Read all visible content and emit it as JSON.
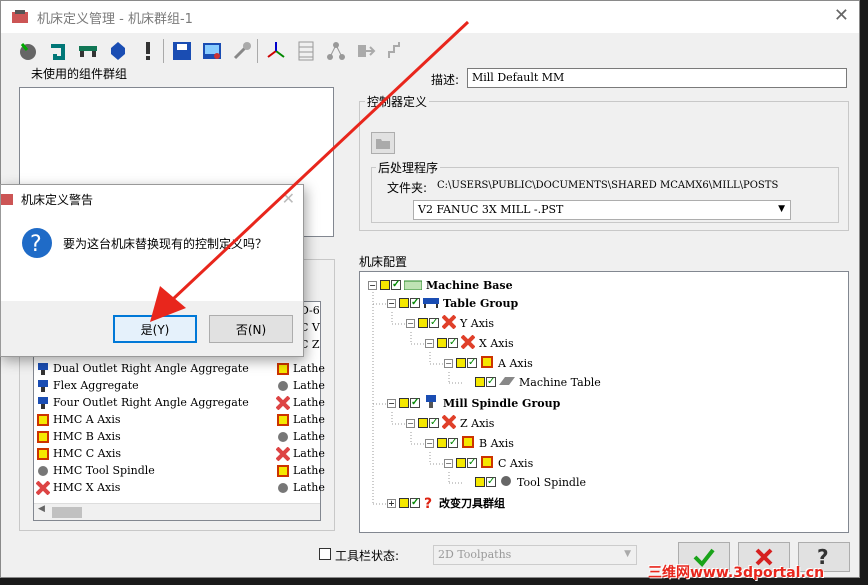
{
  "window": {
    "title": "机床定义管理 - 机床群组-1"
  },
  "toolbar": {
    "icons": [
      "machine-icon",
      "rotate-icon",
      "axis-icon",
      "spindle-icon",
      "warning-icon",
      "save-icon",
      "display-icon",
      "tool-icon",
      "axes-icon",
      "table-icon",
      "tree-icon",
      "export-icon",
      "chart-icon"
    ]
  },
  "left": {
    "unused_label": "未使用的组件群组",
    "list_right_partial": [
      "D-6",
      "C V",
      "C Z"
    ],
    "list_left": [
      {
        "icon": "aggregate",
        "text": "Dual Outlet Right Angle Aggregate"
      },
      {
        "icon": "aggregate",
        "text": "Flex Aggregate"
      },
      {
        "icon": "aggregate",
        "text": "Four Outlet Right Angle Aggregate"
      },
      {
        "icon": "axis",
        "text": "HMC A Axis"
      },
      {
        "icon": "axis",
        "text": "HMC B Axis"
      },
      {
        "icon": "axis",
        "text": "HMC C Axis"
      },
      {
        "icon": "spindle",
        "text": "HMC Tool Spindle"
      },
      {
        "icon": "linear",
        "text": "HMC X Axis"
      }
    ],
    "list_right": [
      "Lathe",
      "Lathe",
      "Lathe",
      "Lathe",
      "Lathe",
      "Lathe",
      "Lathe",
      "Lathe"
    ]
  },
  "right": {
    "desc_label": "描述:",
    "desc_value": "Mill Default MM",
    "controller_label": "控制器定义",
    "post_label": "后处理程序",
    "folder_label": "文件夹:",
    "folder_value": "C:\\USERS\\PUBLIC\\DOCUMENTS\\SHARED MCAMX6\\MILL\\POSTS",
    "post_selected": "V2 FANUC 3X MILL -.PST",
    "config_label": "机床配置",
    "tree": [
      {
        "level": 0,
        "label": "Machine Base",
        "bold": true
      },
      {
        "level": 1,
        "label": "Table Group",
        "bold": true
      },
      {
        "level": 2,
        "label": "Y Axis",
        "bold": false
      },
      {
        "level": 3,
        "label": "X Axis",
        "bold": false
      },
      {
        "level": 4,
        "label": "A Axis",
        "bold": false
      },
      {
        "level": 5,
        "label": "Machine Table",
        "bold": false
      },
      {
        "level": 1,
        "label": "Mill Spindle Group",
        "bold": true
      },
      {
        "level": 2,
        "label": "Z Axis",
        "bold": false
      },
      {
        "level": 3,
        "label": "B Axis",
        "bold": false
      },
      {
        "level": 4,
        "label": "C Axis",
        "bold": false
      },
      {
        "level": 5,
        "label": "Tool Spindle",
        "bold": false
      },
      {
        "level": 1,
        "label": "改变刀具群组",
        "bold": true
      }
    ]
  },
  "bottom": {
    "toolbar_state_label": "工具栏状态:",
    "toolbar_state_value": "2D Toolpaths",
    "ok_icon": "check-icon",
    "cancel_icon": "x-icon",
    "help_icon": "question-icon"
  },
  "dialog": {
    "title": "机床定义警告",
    "message": "要为这台机床替换现有的控制定义吗？",
    "yes": "是(Y)",
    "no": "否(N)"
  },
  "watermark": "三维网www.3dportal.cn",
  "colors": {
    "accent": "#0078d7",
    "annotation": "#e8261c",
    "yellow": "#f5e800"
  }
}
